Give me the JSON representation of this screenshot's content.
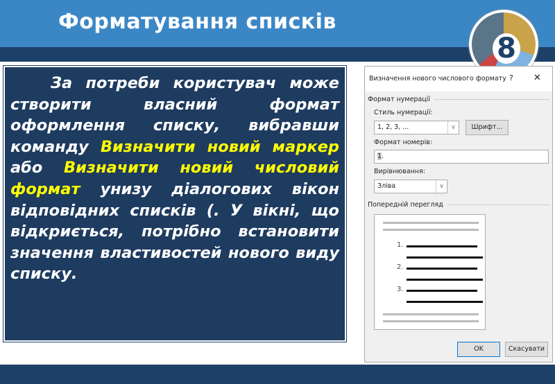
{
  "slide": {
    "title": "Форматування списків",
    "logo_number": "8"
  },
  "body": {
    "p1": "За потреби користувач може створити власний формат оформлення списку, вибравши команду ",
    "h1": "Визначити новий маркер",
    "p2": " або ",
    "h2": "Визначити новий числовий формат",
    "p3": " унизу діалогових вікон відповідних списків (. У вікні, що відкриється, потрібно встановити значення властивостей нового виду списку."
  },
  "dialog": {
    "title": "Визначення нового числового формату",
    "help": "?",
    "close": "✕",
    "group_format": "Формат нумерації",
    "style_label": "Стиль нумерації:",
    "style_value": "1, 2, 3, ...",
    "font_button": "Шрифт...",
    "number_format_label": "Формат номерів:",
    "number_format_value": "1",
    "number_format_suffix": ".",
    "alignment_label": "Вирівнювання:",
    "alignment_value": "Зліва",
    "group_preview": "Попередній перегляд",
    "preview_numbers": [
      "1.",
      "2.",
      "3."
    ],
    "ok": "OK",
    "cancel": "Скасувати"
  }
}
